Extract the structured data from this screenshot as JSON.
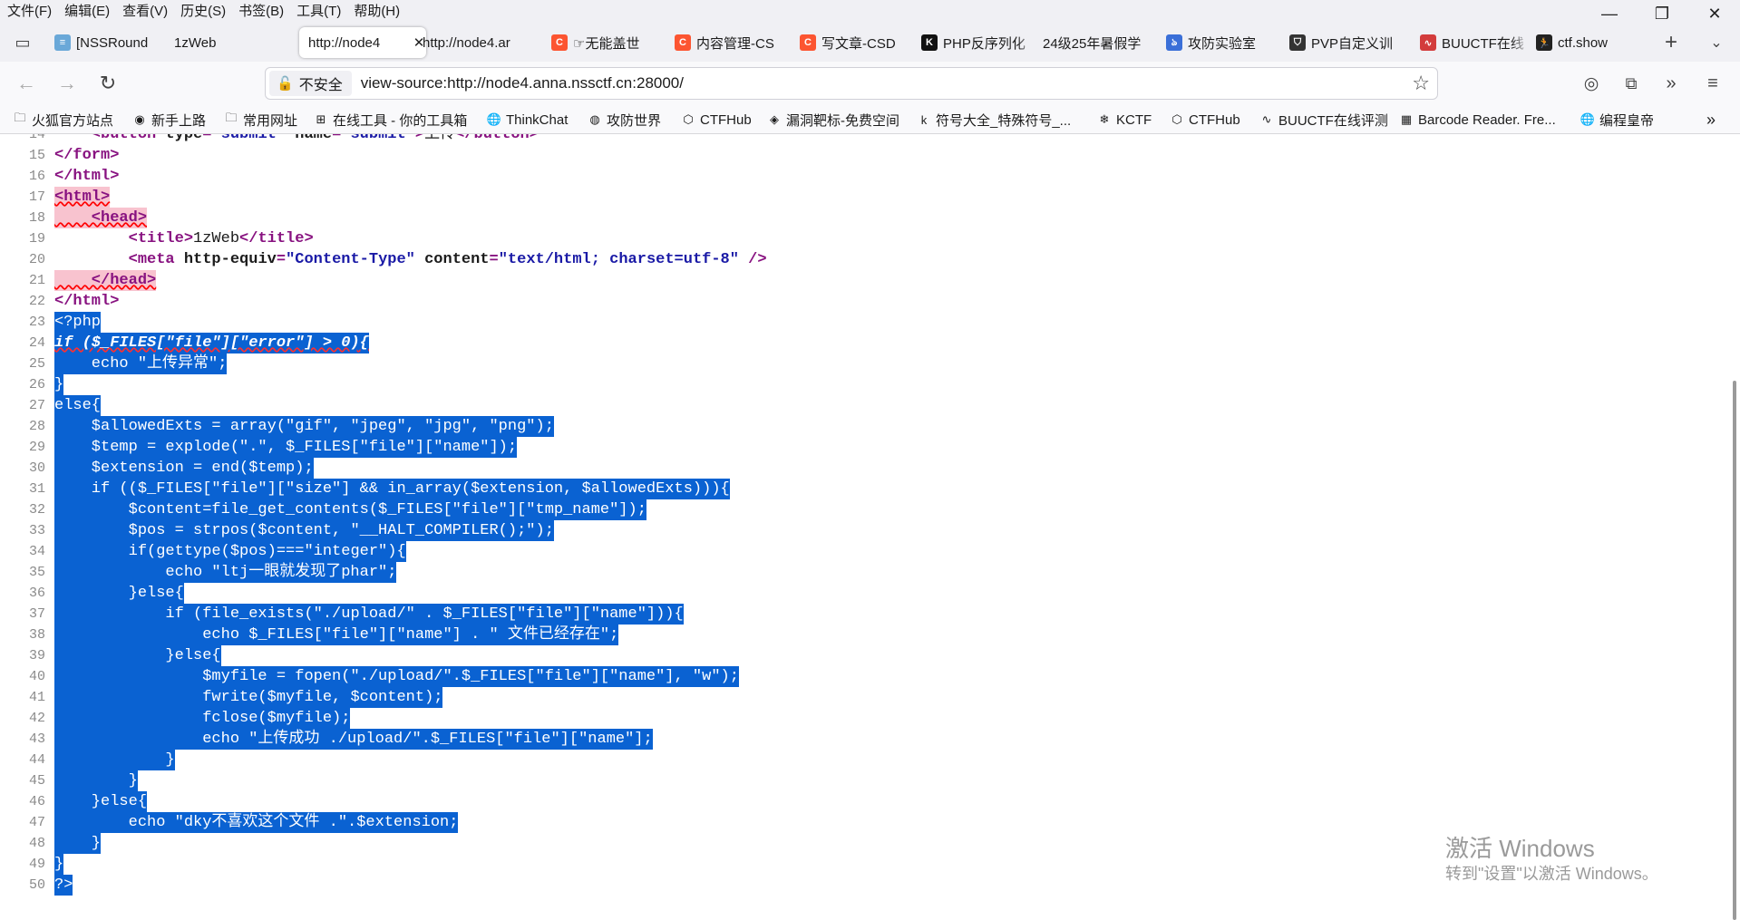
{
  "menu": [
    "文件(F)",
    "编辑(E)",
    "查看(V)",
    "历史(S)",
    "书签(B)",
    "工具(T)",
    "帮助(H)"
  ],
  "window_controls": {
    "minimize": "—",
    "restore": "❐",
    "close": "✕"
  },
  "tabs": [
    {
      "label": "[NSSRound",
      "icon": "nssctf-icon",
      "color": "#6aa8d8"
    },
    {
      "label": "1zWeb",
      "icon": "",
      "color": ""
    },
    {
      "label": "http://node4",
      "icon": "",
      "color": "",
      "active": true
    },
    {
      "label": "http://node4.ar",
      "icon": "",
      "color": ""
    },
    {
      "label": "☞无能盖世",
      "icon": "csdn-icon",
      "color": "#fc5531"
    },
    {
      "label": "内容管理-CS",
      "icon": "csdn-icon",
      "color": "#fc5531"
    },
    {
      "label": "写文章-CSD",
      "icon": "csdn-icon",
      "color": "#fc5531"
    },
    {
      "label": "PHP反序列化",
      "icon": "k-icon",
      "color": "#111111"
    },
    {
      "label": "24级25年暑假学",
      "icon": "",
      "color": ""
    },
    {
      "label": "攻防实验室",
      "icon": "butterfly-icon",
      "color": "#3a6fd8"
    },
    {
      "label": "PVP自定义训",
      "icon": "pvp-icon",
      "color": "#333333"
    },
    {
      "label": "BUUCTF在线",
      "icon": "buu-icon",
      "color": "#d33c3c"
    },
    {
      "label": "ctf.show",
      "icon": "runner-icon",
      "color": "#222222"
    }
  ],
  "navbar": {
    "security_label": "不安全",
    "url": "view-source:http://node4.anna.nssctf.cn:28000/"
  },
  "bookmarks": [
    {
      "label": "火狐官方站点",
      "icon": "folder-icon"
    },
    {
      "label": "新手上路",
      "icon": "firefox-icon"
    },
    {
      "label": "常用网址",
      "icon": "folder-icon"
    },
    {
      "label": "在线工具 - 你的工具箱",
      "icon": "tools-icon"
    },
    {
      "label": "ThinkChat",
      "icon": "globe-icon"
    },
    {
      "label": "攻防世界",
      "icon": "adworld-icon"
    },
    {
      "label": "CTFHub",
      "icon": "ctfhub-icon"
    },
    {
      "label": "漏洞靶标-免费空间",
      "icon": "target-icon"
    },
    {
      "label": "符号大全_特殊符号_...",
      "icon": "ke-icon"
    },
    {
      "label": "KCTF",
      "icon": "kctf-icon"
    },
    {
      "label": "CTFHub",
      "icon": "ctfhub-icon"
    },
    {
      "label": "BUUCTF在线评测",
      "icon": "buu-icon"
    },
    {
      "label": "Barcode Reader. Fre...",
      "icon": "barcode-icon"
    },
    {
      "label": "编程皇帝",
      "icon": "globe-icon"
    }
  ],
  "source_lines": [
    {
      "n": "14",
      "text": "    <button type=\"submit\" name=\"submit\">上传</button>",
      "kind": "tag"
    },
    {
      "n": "15",
      "text": "</form>",
      "kind": "tag"
    },
    {
      "n": "16",
      "text": "</html>",
      "kind": "tag"
    },
    {
      "n": "17",
      "text": "<html>",
      "kind": "err"
    },
    {
      "n": "18",
      "text": "    <head>",
      "kind": "err"
    },
    {
      "n": "19",
      "text": "        <title>1zWeb</title>",
      "kind": "tag"
    },
    {
      "n": "20",
      "text": "        <meta http-equiv=\"Content-Type\" content=\"text/html; charset=utf-8\" />",
      "kind": "tag"
    },
    {
      "n": "21",
      "text": "    </head>",
      "kind": "err"
    },
    {
      "n": "22",
      "text": "</html>",
      "kind": "tag"
    },
    {
      "n": "23",
      "text": "<?php",
      "kind": "sel"
    },
    {
      "n": "24",
      "text": "if ($_FILES[\"file\"][\"error\"] > 0){",
      "kind": "selbad"
    },
    {
      "n": "25",
      "text": "    echo \"上传异常\";",
      "kind": "sel"
    },
    {
      "n": "26",
      "text": "}",
      "kind": "sel"
    },
    {
      "n": "27",
      "text": "else{",
      "kind": "sel"
    },
    {
      "n": "28",
      "text": "    $allowedExts = array(\"gif\", \"jpeg\", \"jpg\", \"png\");",
      "kind": "sel"
    },
    {
      "n": "29",
      "text": "    $temp = explode(\".\", $_FILES[\"file\"][\"name\"]);",
      "kind": "sel"
    },
    {
      "n": "30",
      "text": "    $extension = end($temp);",
      "kind": "sel"
    },
    {
      "n": "31",
      "text": "    if (($_FILES[\"file\"][\"size\"] && in_array($extension, $allowedExts))){",
      "kind": "sel"
    },
    {
      "n": "32",
      "text": "        $content=file_get_contents($_FILES[\"file\"][\"tmp_name\"]);",
      "kind": "sel"
    },
    {
      "n": "33",
      "text": "        $pos = strpos($content, \"__HALT_COMPILER();\");",
      "kind": "sel"
    },
    {
      "n": "34",
      "text": "        if(gettype($pos)===\"integer\"){",
      "kind": "sel"
    },
    {
      "n": "35",
      "text": "            echo \"ltj一眼就发现了phar\";",
      "kind": "sel"
    },
    {
      "n": "36",
      "text": "        }else{",
      "kind": "sel"
    },
    {
      "n": "37",
      "text": "            if (file_exists(\"./upload/\" . $_FILES[\"file\"][\"name\"])){",
      "kind": "sel"
    },
    {
      "n": "38",
      "text": "                echo $_FILES[\"file\"][\"name\"] . \" 文件已经存在\";",
      "kind": "sel"
    },
    {
      "n": "39",
      "text": "            }else{",
      "kind": "sel"
    },
    {
      "n": "40",
      "text": "                $myfile = fopen(\"./upload/\".$_FILES[\"file\"][\"name\"], \"w\");",
      "kind": "sel"
    },
    {
      "n": "41",
      "text": "                fwrite($myfile, $content);",
      "kind": "sel"
    },
    {
      "n": "42",
      "text": "                fclose($myfile);",
      "kind": "sel"
    },
    {
      "n": "43",
      "text": "                echo \"上传成功 ./upload/\".$_FILES[\"file\"][\"name\"];",
      "kind": "sel"
    },
    {
      "n": "44",
      "text": "            }",
      "kind": "sel"
    },
    {
      "n": "45",
      "text": "        }",
      "kind": "sel"
    },
    {
      "n": "46",
      "text": "    }else{",
      "kind": "sel"
    },
    {
      "n": "47",
      "text": "        echo \"dky不喜欢这个文件 .\".$extension;",
      "kind": "sel"
    },
    {
      "n": "48",
      "text": "    }",
      "kind": "sel"
    },
    {
      "n": "49",
      "text": "}",
      "kind": "sel"
    },
    {
      "n": "50",
      "text": "?>",
      "kind": "sel"
    }
  ],
  "watermark": {
    "line1": "激活 Windows",
    "line2": "转到\"设置\"以激活 Windows。"
  },
  "colors": {
    "selection": "#0a62d2",
    "tag": "#881280",
    "attr_value": "#1a1aa6",
    "error_bg": "#f8c3cf"
  }
}
